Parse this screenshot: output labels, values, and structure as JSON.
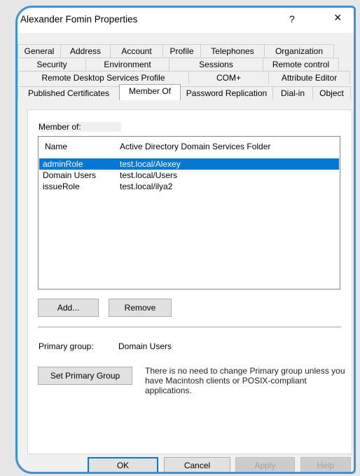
{
  "window": {
    "title": "Alexander Fomin Properties",
    "help": "?",
    "close": "×"
  },
  "tabs": {
    "row1": [
      "General",
      "Address",
      "Account",
      "Profile",
      "Telephones",
      "Organization"
    ],
    "row2": [
      "Security",
      "Environment",
      "Sessions",
      "Remote control"
    ],
    "row3": [
      "Remote Desktop Services Profile",
      "COM+",
      "Attribute Editor"
    ],
    "row4": [
      "Published Certificates",
      "Member Of",
      "Password Replication",
      "Dial-in",
      "Object"
    ],
    "active": "Member Of"
  },
  "member_of": {
    "label": "Member of:",
    "columns": [
      "Name",
      "Active Directory Domain Services Folder"
    ],
    "rows": [
      {
        "name": "adminRole",
        "folder": "test.local/Alexey",
        "selected": true
      },
      {
        "name": "Domain Users",
        "folder": "test.local/Users",
        "selected": false
      },
      {
        "name": "issueRole",
        "folder": "test.local/ilya2",
        "selected": false
      }
    ],
    "add_label": "Add...",
    "remove_label": "Remove"
  },
  "primary_group": {
    "label": "Primary group:",
    "value": "Domain Users",
    "set_button": "Set Primary Group",
    "note": "There is no need to change Primary group unless you have Macintosh clients or POSIX-compliant applications."
  },
  "footer": {
    "ok": "OK",
    "cancel": "Cancel",
    "apply": "Apply",
    "help": "Help"
  },
  "colors": {
    "selection": "#0078d7",
    "frame": "#3a92d8"
  }
}
